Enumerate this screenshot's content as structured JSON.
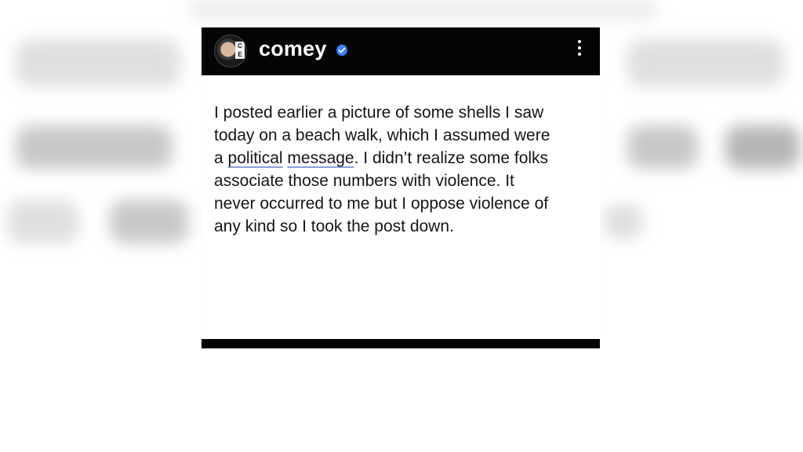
{
  "post": {
    "username": "comey",
    "avatar_badge_text": "C\nE",
    "verified": true,
    "verified_color": "#3b82f6",
    "lines": [
      "I posted earlier a picture of some shells I saw",
      "today on a beach walk, which I assumed were",
      "a ",
      "political",
      " ",
      "message",
      ". I didn’t realize some folks",
      "associate those numbers with violence. It",
      "never occurred to me but I oppose violence of",
      "any kind so I took the post down."
    ],
    "icons": {
      "verified": "verified-badge-icon",
      "more": "more-vertical-icon"
    }
  }
}
